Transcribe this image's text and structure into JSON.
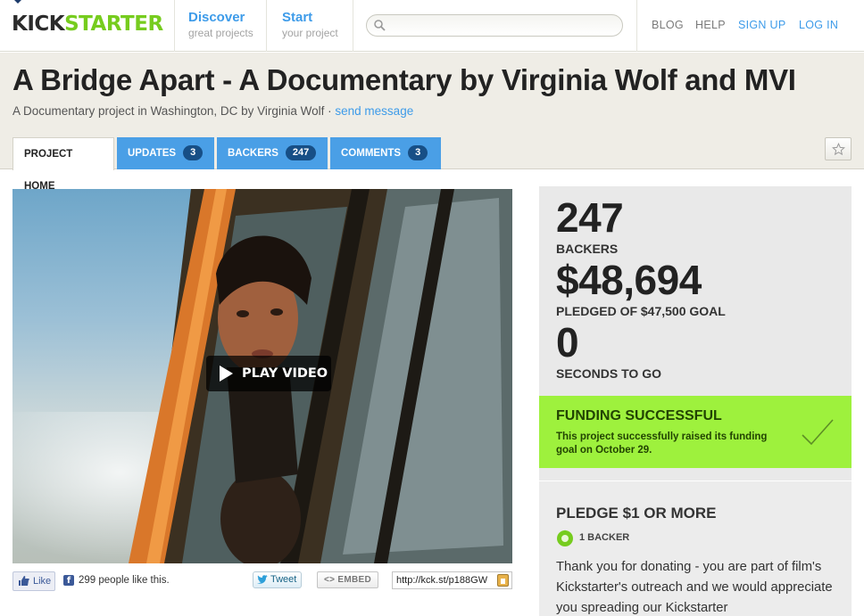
{
  "nav": {
    "logo_kick": "KICK",
    "logo_starter": "STARTER",
    "discover_main": "Discover",
    "discover_sub": "great projects",
    "start_main": "Start",
    "start_sub": "your project",
    "search_placeholder": "",
    "links": [
      "BLOG",
      "HELP",
      "SIGN UP",
      "LOG IN"
    ]
  },
  "project": {
    "title": "A Bridge Apart - A Documentary by Virginia Wolf and MVI",
    "subtitle": "A Documentary project in Washington, DC by Virginia Wolf · ",
    "subtitle_link": "send message"
  },
  "tabs": [
    {
      "label": "PROJECT HOME"
    },
    {
      "label": "UPDATES",
      "count": "3"
    },
    {
      "label": "BACKERS",
      "count": "247"
    },
    {
      "label": "COMMENTS",
      "count": "3"
    }
  ],
  "video": {
    "play_label": "PLAY VIDEO"
  },
  "social": {
    "like_label": "Like",
    "like_text": "299 people like this.",
    "tweet_label": "Tweet",
    "embed_label": "<> EMBED",
    "short_url": "http://kck.st/p188GW"
  },
  "stats": {
    "backers_count": "247",
    "backers_label": "BACKERS",
    "pledged_amount": "$48,694",
    "pledged_label": "PLEDGED OF $47,500 GOAL",
    "time_value": "0",
    "time_label": "SECONDS TO GO"
  },
  "funding": {
    "status": "FUNDING SUCCESSFUL",
    "message": "This project successfully raised its funding goal on October 29."
  },
  "reward": {
    "title": "PLEDGE $1 OR MORE",
    "backers": "1 BACKER",
    "description": "Thank you for donating - you are part of film's Kickstarter's outreach and we would appreciate you spreading our Kickstarter"
  },
  "colors": {
    "accent_blue": "#3d9be9",
    "brand_green": "#76cc1e",
    "success_green": "#9ef13d"
  }
}
